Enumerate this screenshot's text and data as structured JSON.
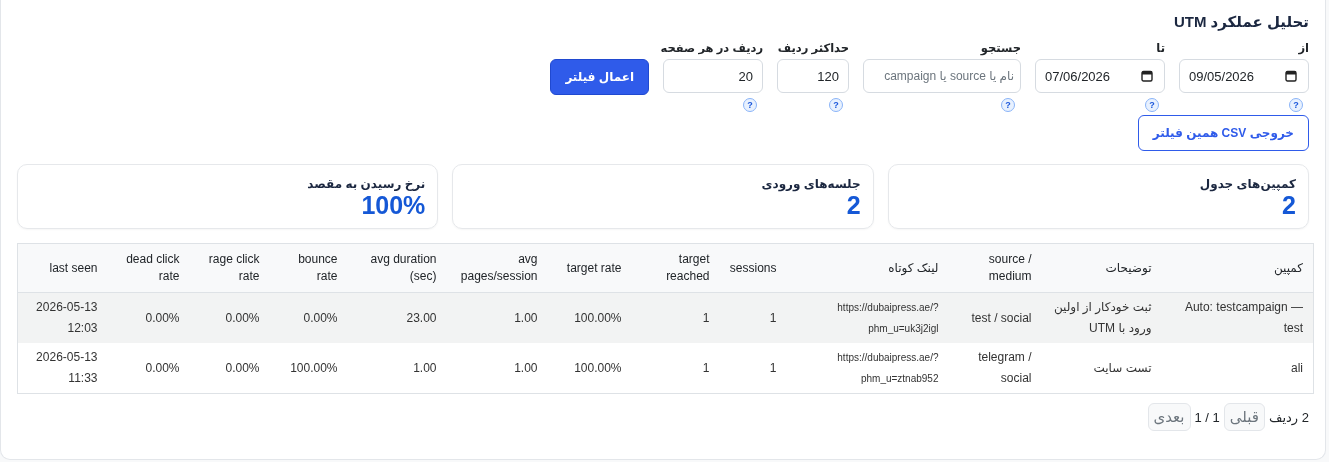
{
  "title": "تحلیل عملکرد UTM",
  "apply_button": "اعمال فیلتر",
  "filters": {
    "from": {
      "kind": "date",
      "label": "از",
      "value": "09/05/2026",
      "help": "?"
    },
    "to": {
      "kind": "date",
      "label": "تا",
      "value": "07/06/2026",
      "help": "?"
    },
    "search": {
      "kind": "search",
      "label": "جستجو",
      "placeholder": "نام یا source یا campaign",
      "help": "?"
    },
    "max_rows": {
      "kind": "number",
      "label": "حداکثر ردیف",
      "value": "120",
      "help": "?"
    },
    "rows_per_page": {
      "kind": "number",
      "label": "ردیف در هر صفحه",
      "value": "20",
      "help": "?"
    }
  },
  "export_button": "خروجی CSV همین فیلتر",
  "stats": {
    "campaigns": {
      "label": "کمپین‌های جدول",
      "value": "2"
    },
    "sessions": {
      "label": "جلسه‌های ورودی",
      "value": "2"
    },
    "target_rate": {
      "label": "نرخ رسیدن به مقصد",
      "value": "100%"
    }
  },
  "table": {
    "columns": [
      "last seen",
      "dead click rate",
      "rage click rate",
      "bounce rate",
      "avg duration (sec)",
      "avg pages/session",
      "target rate",
      "target reached",
      "sessions",
      "لینک کوتاه",
      "source / medium",
      "توضیحات",
      "کمپین"
    ],
    "rows": [
      [
        "2026-05-13 12:03",
        "0.00%",
        "0.00%",
        "0.00%",
        "23.00",
        "1.00",
        "100.00%",
        "1",
        "1",
        "https://dubaipress.ae/?phm_u=uk3j2igl",
        "test / social",
        "ثبت خودکار از اولین ورود با UTM",
        "Auto: testcampaign — test"
      ],
      [
        "2026-05-13 11:33",
        "0.00%",
        "0.00%",
        "100.00%",
        "1.00",
        "1.00",
        "100.00%",
        "1",
        "1",
        "https://dubaipress.ae/?phm_u=ztnab952",
        "telegram / social",
        "تست سایت",
        "ali"
      ]
    ]
  },
  "pagination": {
    "next": {
      "label": "بعدی",
      "disabled": true
    },
    "page": "1 / 1",
    "previous": {
      "label": "قبلی",
      "disabled": true
    },
    "count": "2 ردیف"
  }
}
